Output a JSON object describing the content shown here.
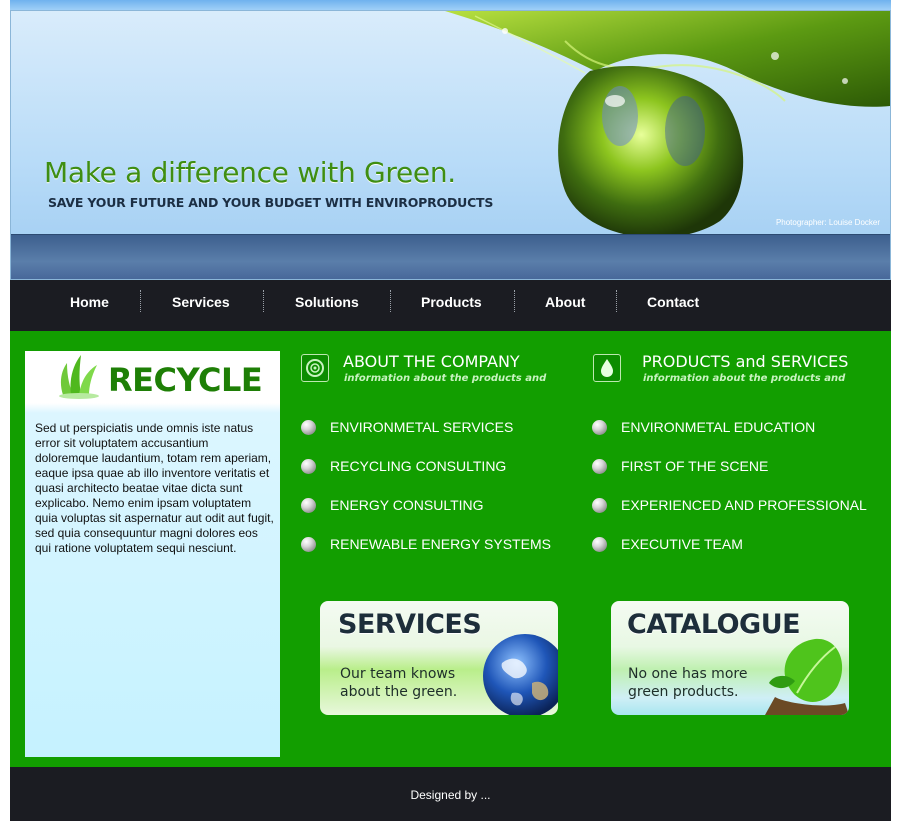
{
  "header": {
    "headline": "Make a difference with Green.",
    "subline": "SAVE YOUR FUTURE AND YOUR BUDGET WITH ENVIROPRODUCTS",
    "photo_credit": "Photographer: Louise Docker"
  },
  "nav": {
    "items": [
      {
        "label": "Home"
      },
      {
        "label": "Services"
      },
      {
        "label": "Solutions"
      },
      {
        "label": "Products"
      },
      {
        "label": "About"
      },
      {
        "label": "Contact"
      }
    ]
  },
  "sidebar": {
    "title": "RECYCLE",
    "icon": "recycle-leaves-icon",
    "text": "Sed ut perspiciatis unde omnis iste natus error sit voluptatem accusantium doloremque laudantium, totam rem aperiam, eaque ipsa quae ab illo inventore veritatis et quasi architecto beatae vitae dicta sunt explicabo. Nemo enim ipsam voluptatem quia voluptas sit aspernatur aut odit aut fugit, sed quia consequuntur magni dolores eos qui ratione voluptatem sequi nesciunt."
  },
  "about": {
    "title": "ABOUT THE COMPANY",
    "subtitle": "information about the products and",
    "icon": "spiral-icon",
    "items": [
      {
        "label": "ENVIRONMETAL SERVICES"
      },
      {
        "label": "RECYCLING CONSULTING"
      },
      {
        "label": "ENERGY CONSULTING"
      },
      {
        "label": "RENEWABLE ENERGY SYSTEMS"
      }
    ]
  },
  "products": {
    "title": "PRODUCTS and SERVICES",
    "subtitle": "information about the products and",
    "icon": "water-drop-icon",
    "items": [
      {
        "label": "ENVIRONMETAL EDUCATION"
      },
      {
        "label": "FIRST OF THE SCENE"
      },
      {
        "label": "EXPERIENCED AND PROFESSIONAL"
      },
      {
        "label": "EXECUTIVE TEAM"
      }
    ]
  },
  "promos": {
    "services": {
      "title": "SERVICES",
      "text_line1": "Our team knows",
      "text_line2": "about the green.",
      "icon": "earth-globe-icon"
    },
    "catalogue": {
      "title": "CATALOGUE",
      "text_line1": "No one has more",
      "text_line2": "green products.",
      "icon": "green-leaf-icon"
    }
  },
  "footer": {
    "text": "Designed by ..."
  },
  "colors": {
    "main_green": "#129e00",
    "nav_dark": "#1b1c22",
    "headline_green": "#3f8e12",
    "sidebar_blue": "#c5f2ff"
  }
}
